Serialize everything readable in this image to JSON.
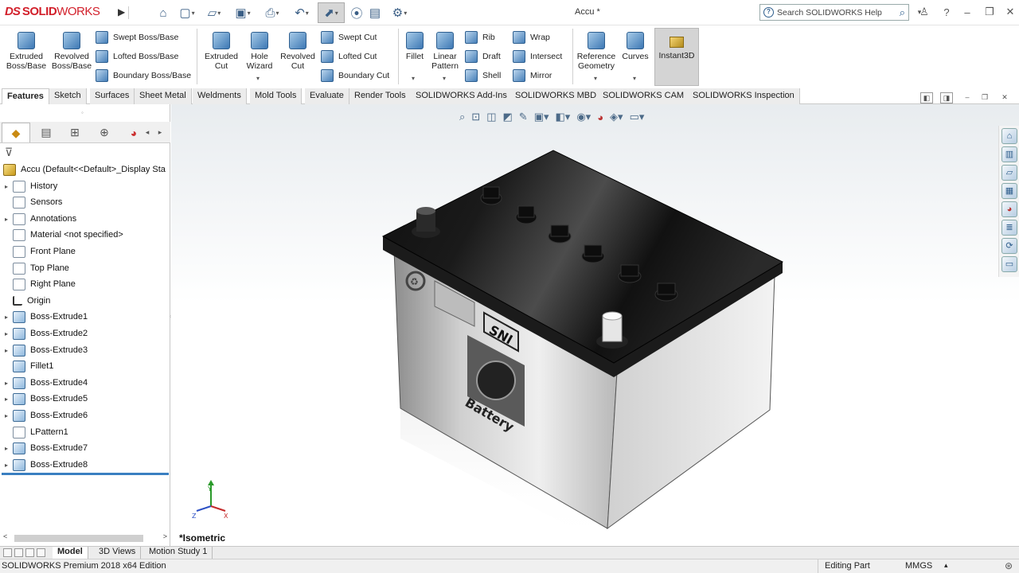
{
  "app": {
    "brand_prefix": "DS",
    "brand_bold": "SOLID",
    "brand_light": "WORKS"
  },
  "window": {
    "title": "Accu *"
  },
  "search": {
    "placeholder": "Search SOLIDWORKS Help"
  },
  "ribbon": {
    "extruded_boss": "Extruded Boss/Base",
    "revolved_boss": "Revolved Boss/Base",
    "swept_boss": "Swept Boss/Base",
    "lofted_boss": "Lofted Boss/Base",
    "boundary_boss": "Boundary Boss/Base",
    "extruded_cut": "Extruded Cut",
    "hole_wizard": "Hole Wizard",
    "revolved_cut": "Revolved Cut",
    "swept_cut": "Swept Cut",
    "lofted_cut": "Lofted Cut",
    "boundary_cut": "Boundary Cut",
    "fillet": "Fillet",
    "linear_pattern": "Linear Pattern",
    "rib": "Rib",
    "draft": "Draft",
    "shell": "Shell",
    "wrap": "Wrap",
    "intersect": "Intersect",
    "mirror": "Mirror",
    "reference_geometry": "Reference Geometry",
    "curves": "Curves",
    "instant3d": "Instant3D"
  },
  "tabs": [
    "Features",
    "Sketch",
    "Surfaces",
    "Sheet Metal",
    "Weldments",
    "Mold Tools",
    "Evaluate",
    "Render Tools",
    "SOLIDWORKS Add-Ins",
    "SOLIDWORKS MBD",
    "SOLIDWORKS CAM",
    "SOLIDWORKS Inspection"
  ],
  "tree": {
    "root": "Accu  (Default<<Default>_Display Sta",
    "items": [
      "History",
      "Sensors",
      "Annotations",
      "Material <not specified>",
      "Front Plane",
      "Top Plane",
      "Right Plane",
      "Origin",
      "Boss-Extrude1",
      "Boss-Extrude2",
      "Boss-Extrude3",
      "Fillet1",
      "Boss-Extrude4",
      "Boss-Extrude5",
      "Boss-Extrude6",
      "LPattern1",
      "Boss-Extrude7",
      "Boss-Extrude8"
    ]
  },
  "viewport": {
    "view_name": "*Isometric",
    "label_sni": "SNI",
    "label_battery": "Battery"
  },
  "bottom_tabs": [
    "Model",
    "3D Views",
    "Motion Study 1"
  ],
  "status": {
    "edition": "SOLIDWORKS Premium 2018 x64 Edition",
    "mode": "Editing Part",
    "units": "MMGS"
  },
  "icons": [
    "home-icon",
    "new-icon",
    "open-icon",
    "save-icon",
    "print-icon",
    "undo-icon",
    "select-icon",
    "rebuild-icon",
    "options-icon",
    "search-icon",
    "user-icon",
    "help-icon",
    "minimize-icon",
    "restore-icon",
    "close-icon"
  ],
  "colors": {
    "brand_red": "#d2202b",
    "accent_blue": "#3a7fc1"
  }
}
